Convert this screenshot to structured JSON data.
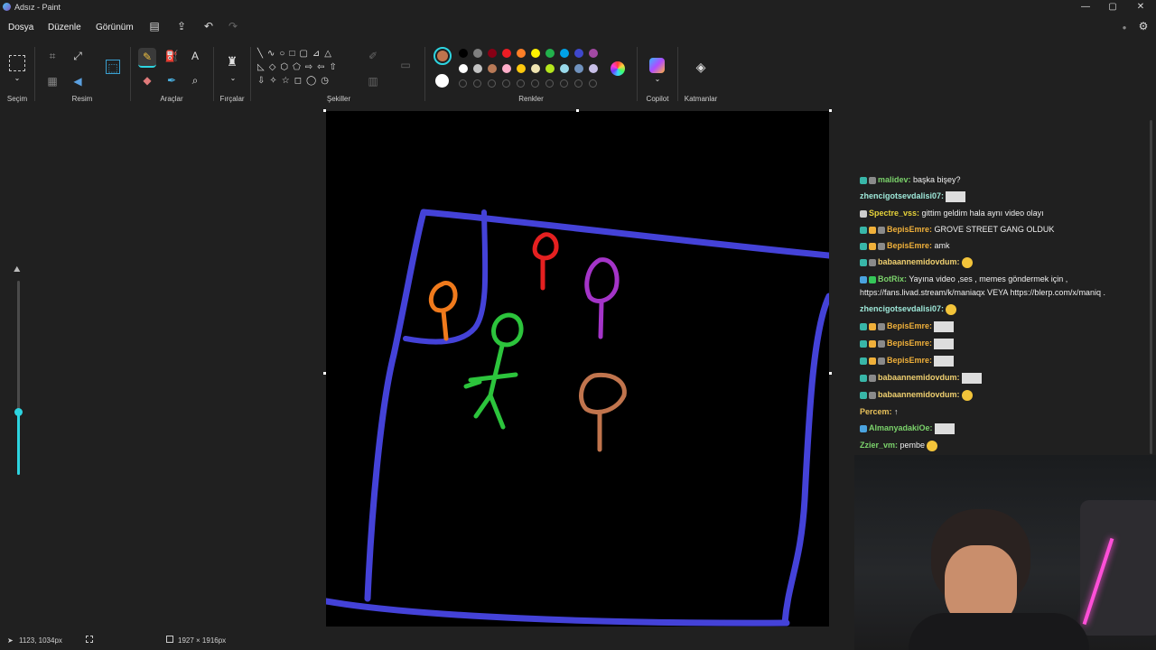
{
  "window": {
    "title": "Adsız - Paint",
    "minimize": "—",
    "maximize": "▢",
    "close": "✕"
  },
  "menu": {
    "file": "Dosya",
    "edit": "Düzenle",
    "view": "Görünüm"
  },
  "ribbon": {
    "groups": {
      "selection": "Seçim",
      "image": "Resim",
      "tools": "Araçlar",
      "brushes": "Fırçalar",
      "shapes": "Şekiller",
      "colors": "Renkler",
      "copilot": "Copilot",
      "layers": "Katmanlar"
    },
    "active_color": "#c0744d",
    "secondary_color": "#ffffff",
    "palette_row1": [
      "#000000",
      "#7f7f7f",
      "#880015",
      "#ed1c24",
      "#ff7f27",
      "#fff200",
      "#22b14c",
      "#00a2e8",
      "#3f48cc",
      "#a349a4"
    ],
    "palette_row2": [
      "#ffffff",
      "#c3c3c3",
      "#b97a57",
      "#ffaec9",
      "#ffc90e",
      "#efe4b0",
      "#b5e61d",
      "#99d9ea",
      "#7092be",
      "#c8bfe7"
    ]
  },
  "status": {
    "cursor_pos": "1123, 1034px",
    "canvas_size": "1927 × 1916px"
  },
  "chat": [
    {
      "user": "malidev",
      "color": "#7bd36b",
      "msg": "başka bişey?",
      "badges": [
        "#38b6a8",
        "#8a8a8a"
      ]
    },
    {
      "user": "zhencigotsevdalisi07",
      "color": "#9ee8d9",
      "msg": "",
      "emote": true,
      "badges": []
    },
    {
      "user": "Spectre_vss",
      "color": "#e6d23a",
      "msg": "gittim geldim hala aynı video olayı",
      "badges": [
        "#cccccc"
      ]
    },
    {
      "user": "BepisEmre",
      "color": "#f0b03a",
      "msg": "GROVE STREET GANG OLDUK",
      "badges": [
        "#38b6a8",
        "#f0b03a",
        "#8a8a8a"
      ]
    },
    {
      "user": "BepisEmre",
      "color": "#f0b03a",
      "msg": "amk",
      "badges": [
        "#38b6a8",
        "#f0b03a",
        "#8a8a8a"
      ]
    },
    {
      "user": "babaannemidovdum",
      "color": "#f0d070",
      "msg": "",
      "emoji": true,
      "badges": [
        "#38b6a8",
        "#8a8a8a"
      ]
    },
    {
      "user": "BotRix",
      "color": "#7bd36b",
      "msg": "Yayına video ,ses , memes göndermek için ,",
      "badges": [
        "#4aa3df",
        "#35c759"
      ]
    },
    {
      "user": "",
      "color": "#f0f0f0",
      "msg": "https://fans.livad.stream/k/maniaqx VEYA https://blerp.com/x/maniq .",
      "badges": []
    },
    {
      "user": "zhencigotsevdalisi07",
      "color": "#9ee8d9",
      "msg": "",
      "emoji": true,
      "badges": []
    },
    {
      "user": "BepisEmre",
      "color": "#f0b03a",
      "msg": "",
      "emote": true,
      "badges": [
        "#38b6a8",
        "#f0b03a",
        "#8a8a8a"
      ]
    },
    {
      "user": "BepisEmre",
      "color": "#f0b03a",
      "msg": "",
      "emote": true,
      "badges": [
        "#38b6a8",
        "#f0b03a",
        "#8a8a8a"
      ]
    },
    {
      "user": "BepisEmre",
      "color": "#f0b03a",
      "msg": "",
      "emote": true,
      "badges": [
        "#38b6a8",
        "#f0b03a",
        "#8a8a8a"
      ]
    },
    {
      "user": "babaannemidovdum",
      "color": "#f0d070",
      "msg": "",
      "emote": true,
      "badges": [
        "#38b6a8",
        "#8a8a8a"
      ]
    },
    {
      "user": "babaannemidovdum",
      "color": "#f0d070",
      "msg": "",
      "emoji": true,
      "badges": [
        "#38b6a8",
        "#8a8a8a"
      ]
    },
    {
      "user": "Percem",
      "color": "#e8c15a",
      "msg": "↑",
      "badges": []
    },
    {
      "user": "AlmanyadakiOe",
      "color": "#7bd36b",
      "msg": "",
      "emote": true,
      "badges": [
        "#4aa3df"
      ]
    },
    {
      "user": "Zzier_vm",
      "color": "#7bd36b",
      "msg": "pembe",
      "emoji": true,
      "badges": []
    }
  ]
}
